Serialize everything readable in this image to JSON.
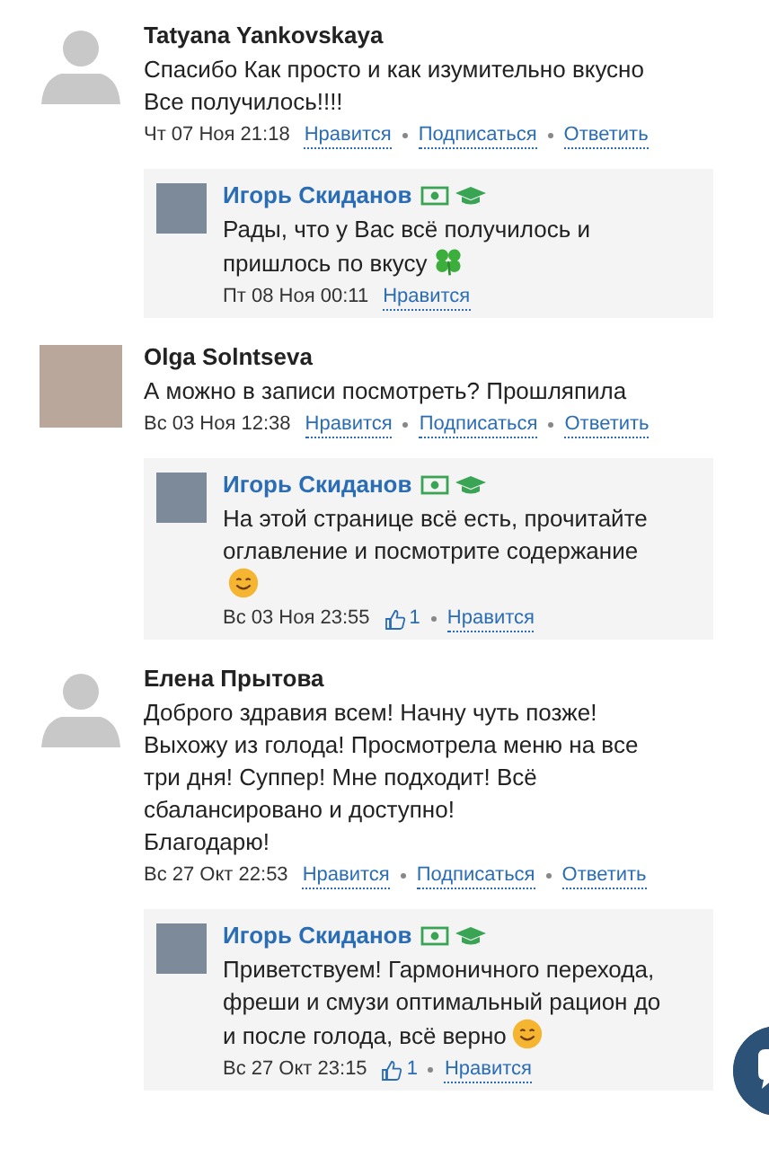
{
  "comments": [
    {
      "author": "Tatyana Yankovskaya",
      "avatar": {
        "kind": "silhouette"
      },
      "text": "Спасибо Как просто и как изумительно вкусно\nВсе получилось!!!!",
      "date": "Чт 07 Ноя 21:18",
      "actions": [
        "Нравится",
        "Подписаться",
        "Ответить"
      ],
      "replies": [
        {
          "author": "Игорь Скиданов",
          "badges": [
            {
              "kind": "money"
            },
            {
              "kind": "graduate"
            }
          ],
          "text": "Рады, что у Вас всё получилось и\nпришлось по вкусу",
          "emoji": {
            "kind": "clover"
          },
          "date": "Пт 08 Ноя 00:11",
          "actions": [
            "Нравится"
          ]
        }
      ]
    },
    {
      "author": "Olga Solntseva",
      "avatar": {
        "kind": "photo"
      },
      "text": "А можно в записи посмотреть? Прошляпила",
      "date": "Вс 03 Ноя 12:38",
      "actions": [
        "Нравится",
        "Подписаться",
        "Ответить"
      ],
      "replies": [
        {
          "author": "Игорь Скиданов",
          "badges": [
            {
              "kind": "money"
            },
            {
              "kind": "graduate"
            }
          ],
          "text": "На этой странице всё есть, прочитайте\nоглавление и посмотрите содержание\n",
          "emoji": {
            "kind": "smile"
          },
          "date": "Вс 03 Ноя 23:55",
          "likes": "1",
          "actions": [
            "Нравится"
          ]
        }
      ]
    },
    {
      "author": "Елена Прытова",
      "avatar": {
        "kind": "silhouette"
      },
      "text": "Доброго здравия всем! Начну чуть позже!\nВыхожу из голода! Просмотрела меню на все\nтри дня! Суппер! Мне подходит! Всё\nсбалансировано и доступно!\nБлагодарю!",
      "date": "Вс 27 Окт 22:53",
      "actions": [
        "Нравится",
        "Подписаться",
        "Ответить"
      ],
      "replies": [
        {
          "author": "Игорь Скиданов",
          "badges": [
            {
              "kind": "money"
            },
            {
              "kind": "graduate"
            }
          ],
          "text": "Приветствуем! Гармоничного перехода,\nфреши и смузи оптимальный рацион до\nи после голода, всё верно",
          "emoji": {
            "kind": "smile"
          },
          "date": "Вс 27 Окт 23:15",
          "likes": "1",
          "actions": [
            "Нравится"
          ]
        }
      ]
    }
  ]
}
